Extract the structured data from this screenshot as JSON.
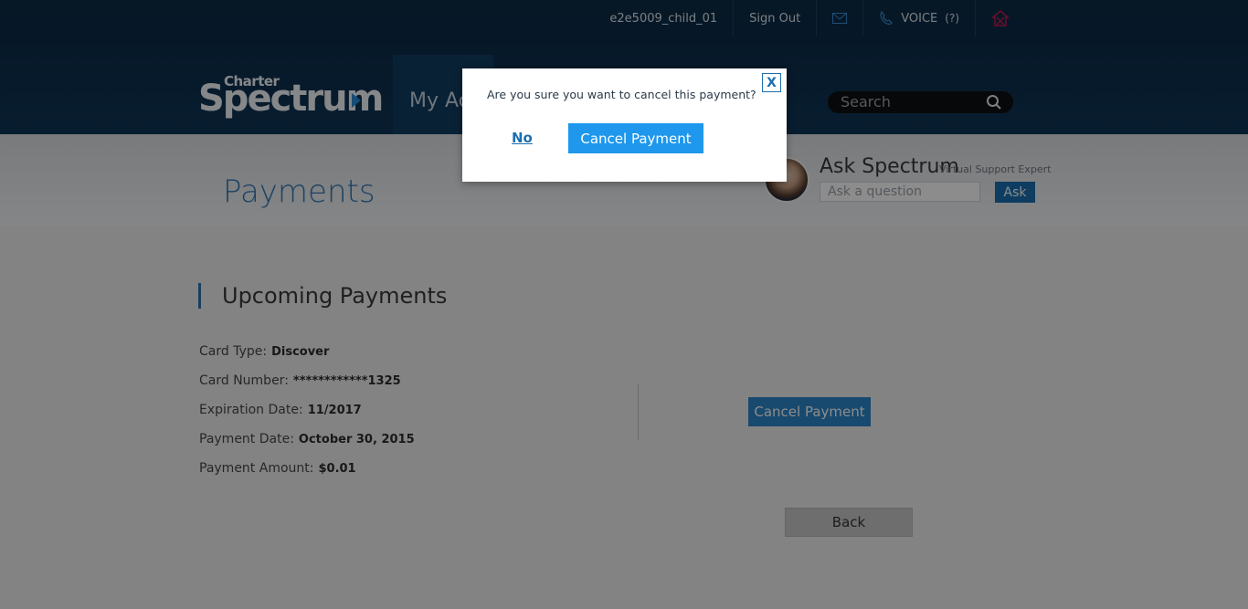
{
  "header": {
    "username": "e2e5009_child_01",
    "sign_out": "Sign Out",
    "voice_label": "VOICE",
    "voice_count": "(?)",
    "logo_small": "Charter",
    "logo_big": "Spectrum",
    "nav_label": "My Ac",
    "search_placeholder": "Search"
  },
  "banner": {
    "page_title": "Payments",
    "ask_title": "Ask Spectrum",
    "ask_subtitle": "Virtual Support Expert",
    "ask_placeholder": "Ask a question",
    "ask_button": "Ask"
  },
  "content": {
    "section_title": "Upcoming Payments",
    "details": [
      {
        "label": "Card Type:",
        "value": "Discover"
      },
      {
        "label": "Card Number:",
        "value": "************1325"
      },
      {
        "label": "Expiration Date:",
        "value": "11/2017"
      },
      {
        "label": "Payment Date:",
        "value": "October 30, 2015"
      },
      {
        "label": "Payment Amount:",
        "value": "$0.01"
      }
    ],
    "cancel_button": "Cancel Payment",
    "back_button": "Back"
  },
  "modal": {
    "close_label": "X",
    "question": "Are you sure you want to cancel this payment?",
    "no_label": "No",
    "confirm_label": "Cancel Payment"
  },
  "colors": {
    "header_bg": "#0f3557",
    "accent_blue": "#1b6fb1",
    "modal_button": "#1e97ec"
  },
  "icons": [
    "mail-icon",
    "phone-icon",
    "home-icon",
    "search-icon"
  ]
}
